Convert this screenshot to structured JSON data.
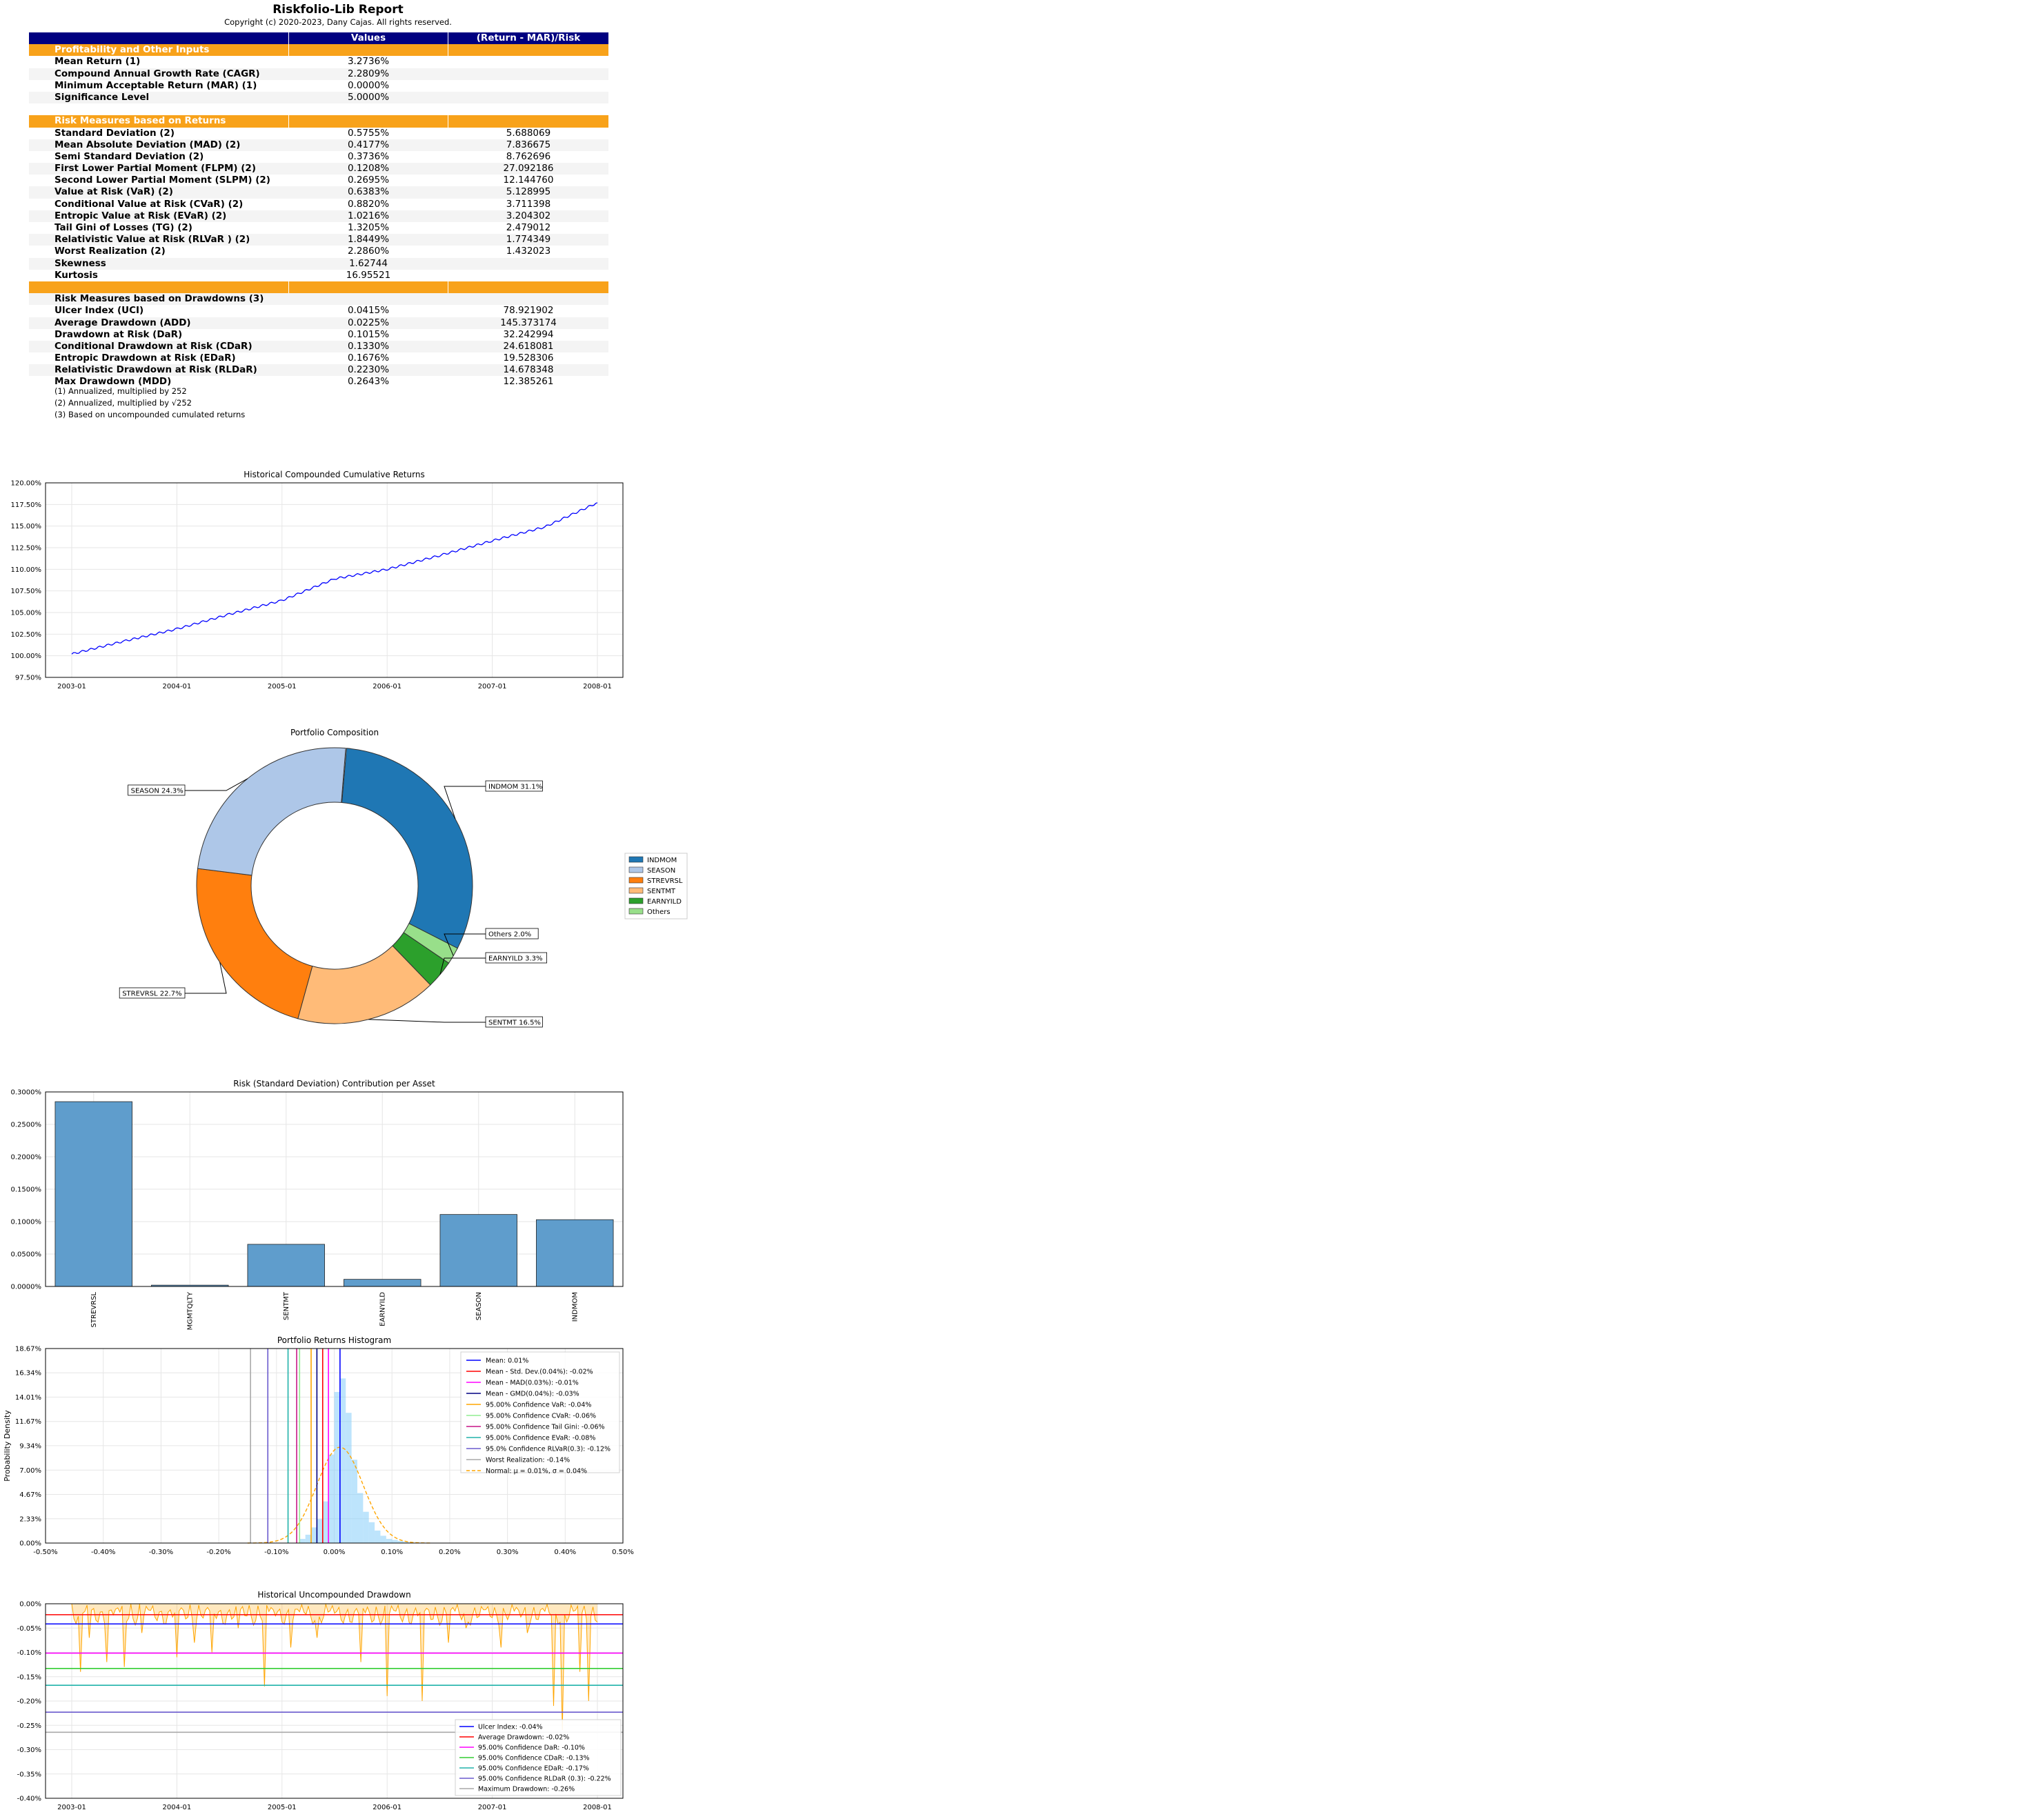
{
  "report": {
    "title": "Riskfolio-Lib Report",
    "copyright": "Copyright (c) 2020-2023, Dany Cajas. All rights reserved."
  },
  "table": {
    "headers": [
      "",
      "Values",
      "(Return - MAR)/Risk"
    ],
    "rows": [
      {
        "label": "Profitability and Other Inputs",
        "style": "band"
      },
      {
        "label": "Mean Return (1)",
        "value": "3.2736%",
        "ratio": ""
      },
      {
        "label": "Compound Annual Growth Rate (CAGR)",
        "value": "2.2809%",
        "ratio": ""
      },
      {
        "label": "Minimum Acceptable Return (MAR) (1)",
        "value": "0.0000%",
        "ratio": ""
      },
      {
        "label": "Significance Level",
        "value": "5.0000%",
        "ratio": ""
      },
      {
        "label": "",
        "style": "spacer"
      },
      {
        "label": "Risk Measures based on Returns",
        "style": "band"
      },
      {
        "label": "Standard Deviation (2)",
        "value": "0.5755%",
        "ratio": "5.688069"
      },
      {
        "label": "Mean Absolute Deviation (MAD) (2)",
        "value": "0.4177%",
        "ratio": "7.836675"
      },
      {
        "label": "Semi Standard Deviation (2)",
        "value": "0.3736%",
        "ratio": "8.762696"
      },
      {
        "label": "First Lower Partial Moment (FLPM) (2)",
        "value": "0.1208%",
        "ratio": "27.092186"
      },
      {
        "label": "Second Lower Partial Moment (SLPM) (2)",
        "value": "0.2695%",
        "ratio": "12.144760"
      },
      {
        "label": "Value at Risk (VaR) (2)",
        "value": "0.6383%",
        "ratio": "5.128995"
      },
      {
        "label": "Conditional Value at Risk (CVaR) (2)",
        "value": "0.8820%",
        "ratio": "3.711398"
      },
      {
        "label": "Entropic Value at Risk (EVaR) (2)",
        "value": "1.0216%",
        "ratio": "3.204302"
      },
      {
        "label": "Tail Gini of Losses (TG) (2)",
        "value": "1.3205%",
        "ratio": "2.479012"
      },
      {
        "label": "Relativistic Value at Risk (RLVaR ) (2)",
        "value": "1.8449%",
        "ratio": "1.774349"
      },
      {
        "label": "Worst Realization (2)",
        "value": "2.2860%",
        "ratio": "1.432023"
      },
      {
        "label": "Skewness",
        "value": "1.62744",
        "ratio": ""
      },
      {
        "label": "Kurtosis",
        "value": "16.95521",
        "ratio": ""
      },
      {
        "label": "",
        "style": "blankband"
      },
      {
        "label": "Risk Measures based on Drawdowns (3)",
        "style": "plain"
      },
      {
        "label": "Ulcer Index (UCI)",
        "value": "0.0415%",
        "ratio": "78.921902"
      },
      {
        "label": "Average Drawdown (ADD)",
        "value": "0.0225%",
        "ratio": "145.373174"
      },
      {
        "label": "Drawdown at Risk (DaR)",
        "value": "0.1015%",
        "ratio": "32.242994"
      },
      {
        "label": "Conditional Drawdown at Risk (CDaR)",
        "value": "0.1330%",
        "ratio": "24.618081"
      },
      {
        "label": "Entropic Drawdown at Risk (EDaR)",
        "value": "0.1676%",
        "ratio": "19.528306"
      },
      {
        "label": "Relativistic Drawdown at Risk (RLDaR)",
        "value": "0.2230%",
        "ratio": "14.678348"
      },
      {
        "label": "Max Drawdown (MDD)",
        "value": "0.2643%",
        "ratio": "12.385261"
      }
    ],
    "notes": [
      "(1) Annualized, multiplied by 252",
      "(2) Annualized, multiplied by √252",
      "(3) Based on uncompounded cumulated returns"
    ]
  },
  "colors": {
    "header_band": "#000080",
    "section_band": "#f8a21a",
    "line": "#0000ff",
    "bar": "#5f9dcc",
    "drawdown": "#ffa500"
  },
  "chart_data": [
    {
      "type": "line",
      "title": "Historical Compounded Cumulative Returns",
      "x_ticks": [
        "2003-01",
        "2004-01",
        "2005-01",
        "2006-01",
        "2007-01",
        "2008-01"
      ],
      "y_ticks": [
        "97.50%",
        "100.00%",
        "102.50%",
        "105.00%",
        "107.50%",
        "110.00%",
        "112.50%",
        "115.00%",
        "117.50%",
        "120.00%"
      ],
      "ylim": [
        97.5,
        120.0
      ],
      "grid": true,
      "series": [
        {
          "x": [
            "2003-01",
            "2003-07",
            "2004-01",
            "2004-07",
            "2005-01",
            "2005-07",
            "2006-01",
            "2006-07",
            "2007-01",
            "2007-07",
            "2008-01"
          ],
          "values": [
            100.2,
            101.7,
            103.1,
            104.8,
            106.4,
            108.9,
            110.0,
            111.6,
            113.3,
            114.9,
            117.7
          ]
        }
      ]
    },
    {
      "type": "pie",
      "title": "Portfolio Composition",
      "legend_position": "right",
      "slices": [
        {
          "label": "INDMOM",
          "value": 31.1,
          "text": "INDMOM 31.1%",
          "color": "#1f77b4"
        },
        {
          "label": "Others",
          "value": 2.0,
          "text": "Others 2.0%",
          "color": "#98df8a"
        },
        {
          "label": "EARNYILD",
          "value": 3.3,
          "text": "EARNYILD 3.3%",
          "color": "#2ca02c"
        },
        {
          "label": "SENTMT",
          "value": 16.5,
          "text": "SENTMT 16.5%",
          "color": "#ffbb78"
        },
        {
          "label": "STREVRSL",
          "value": 22.7,
          "text": "STREVRSL 22.7%",
          "color": "#ff7f0e"
        },
        {
          "label": "SEASON",
          "value": 24.3,
          "text": "SEASON 24.3%",
          "color": "#aec7e8"
        }
      ],
      "legend": [
        "INDMOM",
        "SEASON",
        "STREVRSL",
        "SENTMT",
        "EARNYILD",
        "Others"
      ]
    },
    {
      "type": "bar",
      "title": "Risk (Standard Deviation) Contribution per Asset",
      "categories": [
        "STREVRSL",
        "MGMTQLTY",
        "SENTMT",
        "EARNYILD",
        "SEASON",
        "INDMOM"
      ],
      "values": [
        0.285,
        0.002,
        0.065,
        0.011,
        0.111,
        0.103
      ],
      "y_ticks": [
        "0.0000%",
        "0.0500%",
        "0.1000%",
        "0.1500%",
        "0.2000%",
        "0.2500%",
        "0.3000%"
      ],
      "ylim": [
        0,
        0.3
      ],
      "grid": true
    },
    {
      "type": "histogram",
      "title": "Portfolio Returns Histogram",
      "ylabel": "Probability Density",
      "x_ticks": [
        "-0.50%",
        "-0.40%",
        "-0.30%",
        "-0.20%",
        "-0.10%",
        "0.00%",
        "0.10%",
        "0.20%",
        "0.30%",
        "0.40%",
        "0.50%"
      ],
      "y_ticks": [
        "0.00%",
        "2.33%",
        "4.67%",
        "7.00%",
        "9.34%",
        "11.67%",
        "14.01%",
        "16.34%",
        "18.67%"
      ],
      "xlim": [
        -0.5,
        0.5
      ],
      "ylim": [
        0,
        18.67
      ],
      "bins": {
        "x": [
          -0.06,
          -0.05,
          -0.04,
          -0.03,
          -0.02,
          -0.01,
          0.0,
          0.01,
          0.02,
          0.03,
          0.04,
          0.05,
          0.06,
          0.07,
          0.08,
          0.09,
          0.1,
          0.11,
          0.12
        ],
        "values": [
          0.4,
          0.8,
          1.5,
          2.3,
          4.0,
          8.5,
          14.5,
          15.8,
          12.5,
          8.0,
          4.8,
          3.0,
          2.0,
          1.2,
          0.7,
          0.4,
          0.3,
          0.2,
          0.1
        ]
      },
      "normal_curve": {
        "mu": 0.01,
        "sigma": 0.04
      },
      "vlines": [
        {
          "label": "Mean: 0.01%",
          "x": 0.01,
          "color": "#0000ff"
        },
        {
          "label": "Mean - Std. Dev.(0.04%): -0.02%",
          "x": -0.02,
          "color": "#ff0000"
        },
        {
          "label": "Mean - MAD(0.03%): -0.01%",
          "x": -0.01,
          "color": "#ff00ff"
        },
        {
          "label": "Mean - GMD(0.04%): -0.03%",
          "x": -0.03,
          "color": "#000080"
        },
        {
          "label": "95.00% Confidence VaR: -0.04%",
          "x": -0.04,
          "color": "#ffa500"
        },
        {
          "label": "95.00% Confidence CVaR: -0.06%",
          "x": -0.06,
          "color": "#90ee90"
        },
        {
          "label": "95.00% Confidence Tail Gini: -0.06%",
          "x": -0.065,
          "color": "#c71585"
        },
        {
          "label": "95.00% Confidence EVaR: -0.08%",
          "x": -0.08,
          "color": "#20b2aa"
        },
        {
          "label": "95.0% Confidence RLVaR(0.3): -0.12%",
          "x": -0.115,
          "color": "#6a5acd"
        },
        {
          "label": "Worst Realization: -0.14%",
          "x": -0.145,
          "color": "#a9a9a9"
        },
        {
          "label": "Normal: μ = 0.01%, σ = 0.04%",
          "x": null,
          "color": "#ffa500",
          "dashed": true
        }
      ],
      "grid": true
    },
    {
      "type": "area",
      "title": "Historical Uncompounded Drawdown",
      "x_ticks": [
        "2003-01",
        "2004-01",
        "2005-01",
        "2006-01",
        "2007-01",
        "2008-01"
      ],
      "y_ticks": [
        "0.00%",
        "-0.05%",
        "-0.10%",
        "-0.15%",
        "-0.20%",
        "-0.25%",
        "-0.30%",
        "-0.35%",
        "-0.40%"
      ],
      "ylim": [
        -0.4,
        0.0
      ],
      "hlines": [
        {
          "label": "Ulcer Index: -0.04%",
          "y": -0.0415,
          "color": "#0000ff"
        },
        {
          "label": "Average Drawdown: -0.02%",
          "y": -0.0225,
          "color": "#ff0000"
        },
        {
          "label": "95.00% Confidence DaR: -0.10%",
          "y": -0.1015,
          "color": "#ff00ff"
        },
        {
          "label": "95.00% Confidence CDaR: -0.13%",
          "y": -0.133,
          "color": "#32cd32"
        },
        {
          "label": "95.00% Confidence EDaR: -0.17%",
          "y": -0.1676,
          "color": "#20b2aa"
        },
        {
          "label": "95.00% Confidence RLDaR (0.3): -0.22%",
          "y": -0.223,
          "color": "#6a5acd"
        },
        {
          "label": "Maximum Drawdown: -0.26%",
          "y": -0.2643,
          "color": "#a9a9a9"
        }
      ],
      "spikes": {
        "x": [
          "2003-02",
          "2003-03",
          "2003-05",
          "2003-07",
          "2003-09",
          "2004-01",
          "2004-03",
          "2004-05",
          "2004-08",
          "2004-11",
          "2005-02",
          "2005-05",
          "2005-08",
          "2005-10",
          "2006-01",
          "2006-05",
          "2006-08",
          "2006-10",
          "2007-02",
          "2007-05",
          "2007-08",
          "2007-09",
          "2007-11",
          "2007-12"
        ],
        "values": [
          -0.14,
          -0.07,
          -0.12,
          -0.13,
          -0.06,
          -0.11,
          -0.08,
          -0.1,
          -0.05,
          -0.17,
          -0.09,
          -0.07,
          -0.04,
          -0.12,
          -0.19,
          -0.2,
          -0.08,
          -0.05,
          -0.09,
          -0.06,
          -0.21,
          -0.26,
          -0.14,
          -0.2
        ]
      },
      "legend_position": "lower right",
      "grid": true
    }
  ]
}
